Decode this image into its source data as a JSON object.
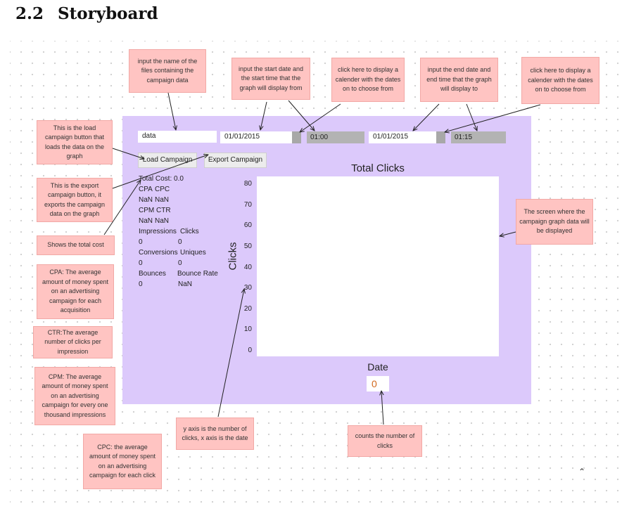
{
  "heading": {
    "number": "2.2",
    "title": "Storyboard"
  },
  "ui": {
    "file_input": "data",
    "start_date": "01/01/2015",
    "start_time": "01:00",
    "end_date": "01/01/2015",
    "end_time": "01:15",
    "load_button": "Load Campaign",
    "export_button": "Export Campaign",
    "stats": {
      "total_cost": "Total Cost: 0.0",
      "cpa_label": "CPA",
      "cpc_label": "CPC",
      "cpa_value": "NaN",
      "cpc_value": "NaN",
      "cpm_label": "CPM",
      "ctr_label": "CTR",
      "cpm_value": "NaN",
      "ctr_value": "NaN",
      "impressions_label": "Impressions",
      "clicks_label": "Clicks",
      "impressions_value": "0",
      "clicks_value": "0",
      "conversions_label": "Conversions",
      "uniques_label": "Uniques",
      "conversions_value": "0",
      "uniques_value": "0",
      "bounces_label": "Bounces",
      "bounce_rate_label": "Bounce Rate",
      "bounces_value": "0",
      "bounce_rate_value": "NaN"
    },
    "counter": "0"
  },
  "chart_data": {
    "type": "line",
    "title": "Total Clicks",
    "xlabel": "Date",
    "ylabel": "Clicks",
    "yticks": [
      "80",
      "70",
      "60",
      "50",
      "40",
      "30",
      "20",
      "10",
      "0"
    ],
    "ylim": [
      0,
      80
    ],
    "series": []
  },
  "notes": {
    "filename": "input the name of the files containing the campaign data",
    "start_date": "input the start date and the start time that the graph will display from",
    "calendar_start": "click here to display a calender with the dates on to choose from",
    "end_date": "input the end date and end time that the graph will display to",
    "calendar_end": "click here to display a calender with the dates on to choose from",
    "load": "This is the load campaign button that loads the data on the graph",
    "export": "This is the export campaign button, it exports the campaign data on the graph",
    "total_cost": "Shows the total cost",
    "cpa": "CPA: The average amount of money spent on an advertising campaign for each acquisition",
    "ctr": "CTR:The average number of clicks per impression",
    "cpm": "CPM: The average amount of money spent on an advertising campaign for every one thousand impressions",
    "cpc": "CPC: the average amount of money spent on an advertising campaign for each click",
    "axis": "y axis is the number of clicks, x axis is the date",
    "counter": "counts the number of clicks",
    "screen": "The screen where the campaign graph data will be displayed"
  },
  "colors": {
    "panel": "#dcc9fb",
    "note": "#ffc4c2",
    "counter_text": "#d2691e"
  }
}
